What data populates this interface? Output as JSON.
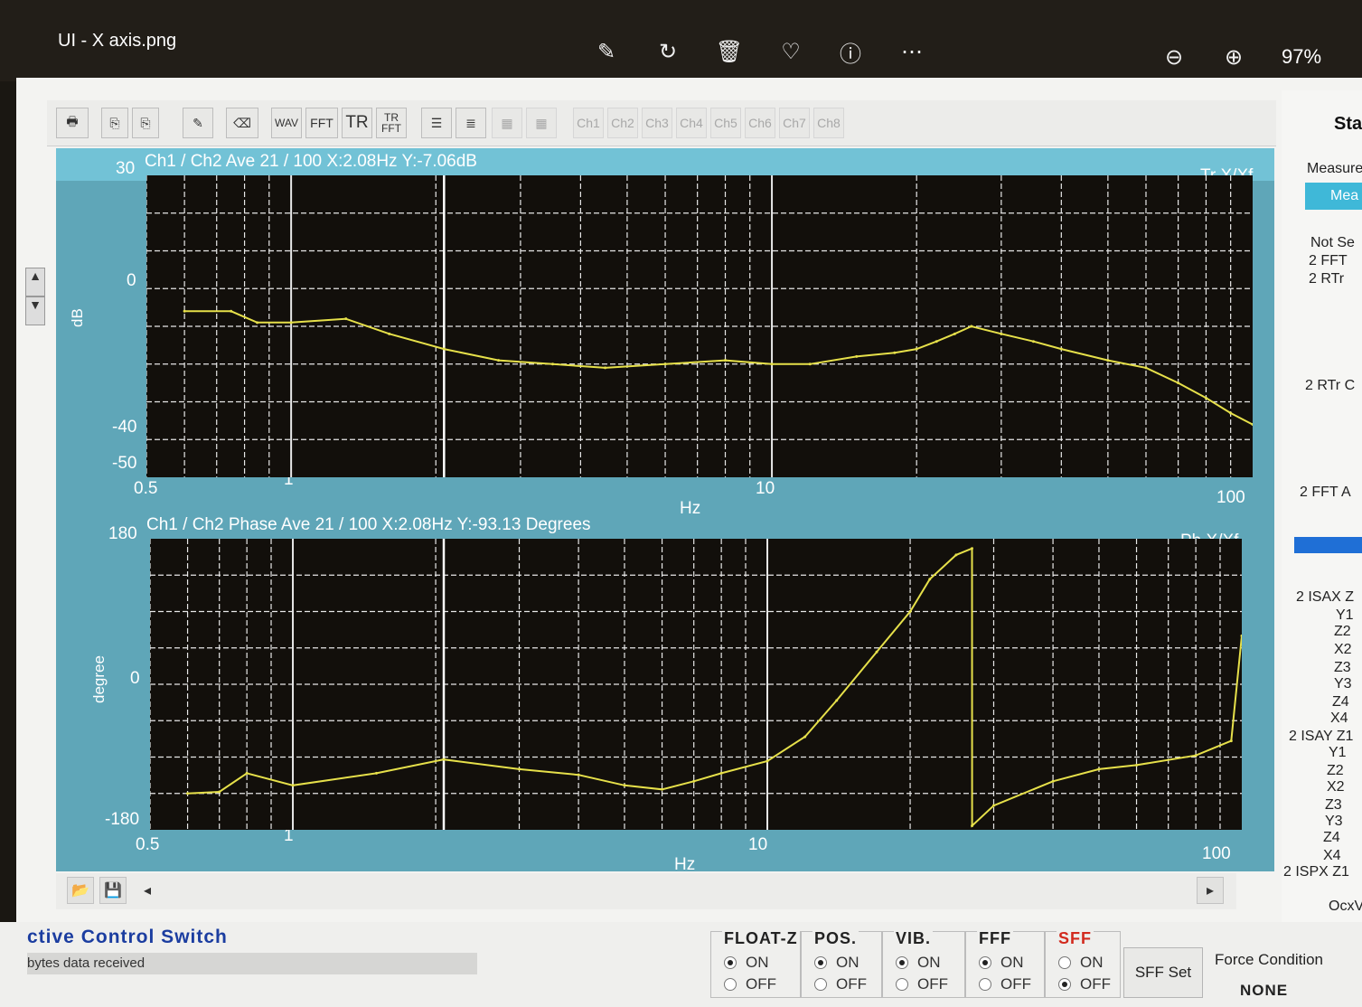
{
  "viewer": {
    "title": "UI - X axis.png",
    "zoom": "97%",
    "icons": [
      "edit-image-icon",
      "rotate-icon",
      "delete-icon",
      "favorite-icon",
      "info-icon",
      "more-icon"
    ],
    "zoom_out_icon": "zoom-out-icon",
    "zoom_in_icon": "zoom-in-icon"
  },
  "toolbar": {
    "print": "print-icon",
    "copy1": "copy-icon",
    "copy2": "copy-alt-icon",
    "pen": "pen-icon",
    "eraser": "eraser-icon",
    "wav": "WAV",
    "fft": "FFT",
    "tr": "TR",
    "tr_fft_top": "TR",
    "tr_fft_bottom": "FFT",
    "channels": [
      "Ch1",
      "Ch2",
      "Ch3",
      "Ch4",
      "Ch5",
      "Ch6",
      "Ch7",
      "Ch8"
    ]
  },
  "plots": {
    "top": {
      "header": "Ch1 / Ch2   Ave 21 / 100   X:2.08Hz   Y:-7.06dB",
      "tag": "Tr X/Xf",
      "ylabel": "dB",
      "y_ticks": [
        "30",
        "0",
        "-40",
        "-50"
      ],
      "x_ticks": [
        "0.5",
        "1",
        "10",
        "100"
      ],
      "xlabel": "Hz"
    },
    "bottom": {
      "header": "Ch1 / Ch2   Phase Ave 21 / 100   X:2.08Hz   Y:-93.13 Degrees",
      "tag": "Ph X/Xf",
      "ylabel": "degree",
      "y_ticks": [
        "180",
        "0",
        "-180"
      ],
      "x_ticks": [
        "0.5",
        "1",
        "10",
        "100"
      ],
      "xlabel": "Hz"
    }
  },
  "chart_data": [
    {
      "type": "line",
      "title": "Ch1 / Ch2   Ave 21 / 100   X:2.08Hz   Y:-7.06dB",
      "xlabel": "Hz",
      "ylabel": "dB",
      "xscale": "log",
      "xlim": [
        0.5,
        100
      ],
      "ylim": [
        -50,
        30
      ],
      "grid": true,
      "cursor_x": 2.08,
      "series": [
        {
          "name": "Tr X/Xf",
          "x": [
            0.6,
            0.75,
            0.85,
            1.0,
            1.3,
            1.6,
            2.08,
            2.7,
            3.5,
            4.5,
            6,
            8,
            10,
            12,
            15,
            18,
            20,
            22,
            24,
            26,
            30,
            35,
            40,
            50,
            60,
            70,
            80,
            90,
            100
          ],
          "y": [
            -6,
            -6,
            -9,
            -9,
            -8,
            -12,
            -16,
            -19,
            -20,
            -21,
            -20,
            -19,
            -20,
            -20,
            -18,
            -17,
            -16,
            -14,
            -12,
            -10,
            -12,
            -14,
            -16,
            -19,
            -21,
            -25,
            -29,
            -33,
            -36
          ]
        }
      ]
    },
    {
      "type": "line",
      "title": "Ch1 / Ch2   Phase Ave 21 / 100   X:2.08Hz   Y:-93.13 Degrees",
      "xlabel": "Hz",
      "ylabel": "degree",
      "xscale": "log",
      "xlim": [
        0.5,
        100
      ],
      "ylim": [
        -180,
        180
      ],
      "grid": true,
      "cursor_x": 2.08,
      "series": [
        {
          "name": "Ph X/Xf",
          "x": [
            0.6,
            0.7,
            0.8,
            1.0,
            1.5,
            2.08,
            3,
            4,
            5,
            6,
            7,
            8,
            10,
            12,
            14,
            17,
            20,
            22,
            25,
            27,
            27.01,
            30,
            40,
            50,
            60,
            80,
            95,
            100
          ],
          "y": [
            -135,
            -133,
            -110,
            -125,
            -110,
            -93,
            -105,
            -112,
            -125,
            -130,
            -120,
            -110,
            -95,
            -65,
            -20,
            40,
            90,
            130,
            160,
            168,
            -175,
            -150,
            -120,
            -105,
            -100,
            -88,
            -70,
            60
          ]
        }
      ]
    }
  ],
  "right_panel": {
    "tab": "Sta",
    "measure_label": "Measure",
    "measure_button": "Mea",
    "items": [
      "Not Se",
      "2 FFT",
      "2 RTr",
      "2 RTr C",
      "2 FFT A",
      "2 ISAX Z",
      "Y1",
      "Z2",
      "X2",
      "Z3",
      "Y3",
      "Z4",
      "X4",
      "2 ISAY Z1",
      "Y1",
      "Z2",
      "X2",
      "Z3",
      "Y3",
      "Z4",
      "X4",
      "2 ISPX Z1",
      "OcxV"
    ]
  },
  "controls": {
    "title": "ctive Control Switch",
    "status": "bytes data received",
    "groups": [
      {
        "title": "FLOAT-Z",
        "on": "ON",
        "off": "OFF",
        "selected": "ON",
        "color": "#222222"
      },
      {
        "title": "POS.",
        "on": "ON",
        "off": "OFF",
        "selected": "ON",
        "color": "#222222"
      },
      {
        "title": "VIB.",
        "on": "ON",
        "off": "OFF",
        "selected": "ON",
        "color": "#222222"
      },
      {
        "title": "FFF",
        "on": "ON",
        "off": "OFF",
        "selected": "ON",
        "color": "#222222"
      },
      {
        "title": "SFF",
        "on": "ON",
        "off": "OFF",
        "selected": "OFF",
        "color": "#d22a1e"
      }
    ],
    "sff_set": "SFF Set",
    "force_label": "Force Condition",
    "force_value": "NONE"
  },
  "colors": {
    "trace": "#e6e04a",
    "grid": "#e8e8e8",
    "plot_bg": "#120f0b",
    "frame": "#5fa6b8"
  }
}
